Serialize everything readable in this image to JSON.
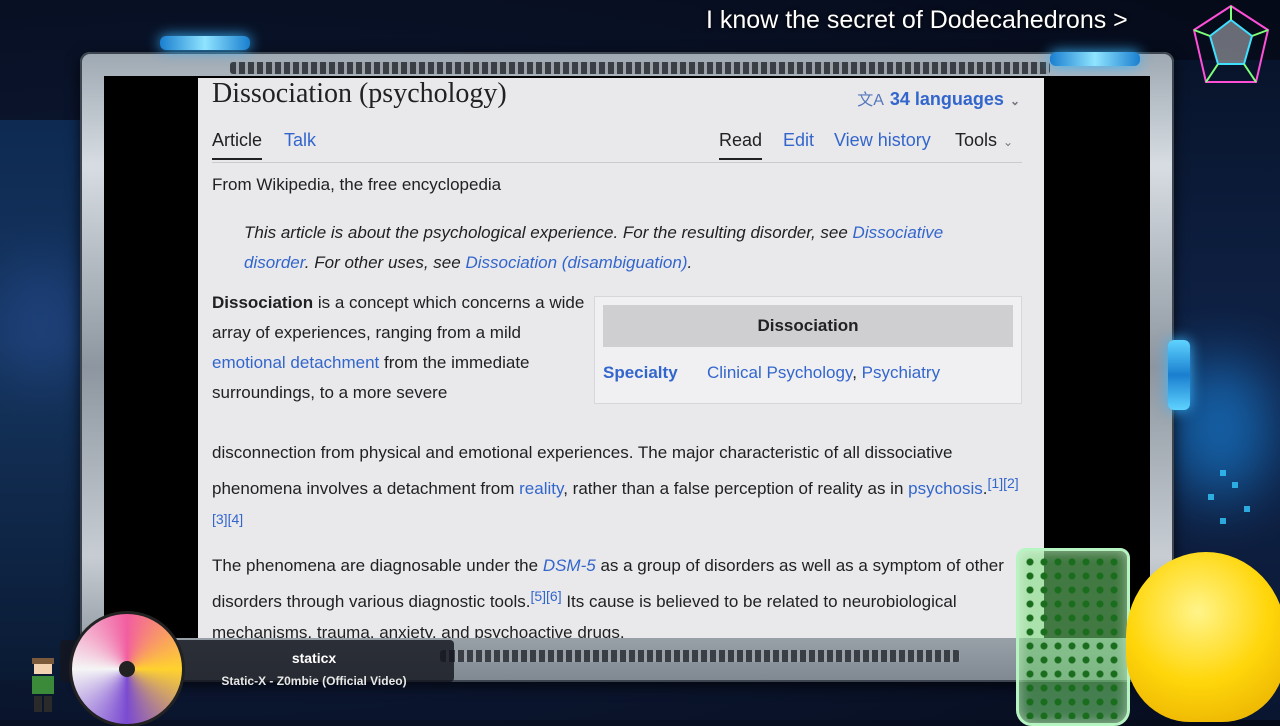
{
  "overlay": {
    "top_text": "I know the secret of Dodecahedrons >"
  },
  "wiki": {
    "title": "Dissociation (psychology)",
    "languages": "34 languages",
    "tabs_left": [
      "Article",
      "Talk"
    ],
    "tabs_right": [
      "Read",
      "Edit",
      "View history",
      "Tools"
    ],
    "from": "From Wikipedia, the free encyclopedia",
    "hatnote": {
      "p1": "This article is about the psychological experience. For the resulting disorder, see ",
      "link1": "Dissociative disorder",
      "p2": ". For other uses, see ",
      "link2": "Dissociation (disambiguation)",
      "p3": "."
    },
    "lead": {
      "bold": "Dissociation",
      "t1": " is a concept which concerns a wide array of experiences, ranging from a mild ",
      "link1": "emotional detachment",
      "t2": " from the immediate surroundings, to a more severe",
      "t3": "disconnection from physical and emotional experiences. The major characteristic of all dissociative phenomena involves a detachment from ",
      "link2": "reality",
      "t4": ", rather than a false perception of reality as in ",
      "link3": "psychosis",
      "t5": ".",
      "refs": "[1][2][3][4]"
    },
    "para2": {
      "t1": "The phenomena are diagnosable under the ",
      "link1": "DSM-5",
      "t2": " as a group of disorders as well as a symptom of other disorders through various diagnostic tools.",
      "refs": "[5][6]",
      "t3": " Its cause is believed to be related to neurobiological mechanisms, trauma, anxiety, and psychoactive drugs."
    },
    "infobox": {
      "heading": "Dissociation",
      "key": "Specialty",
      "val1": "Clinical Psychology",
      "sep": ", ",
      "val2": "Psychiatry"
    }
  },
  "music": {
    "artist": "staticx",
    "track": "Static-X - Z0mbie (Official Video)"
  },
  "colors": {
    "link": "#3366cc",
    "page_bg": "#e9e9ec",
    "frame": "#c7cdd3"
  }
}
